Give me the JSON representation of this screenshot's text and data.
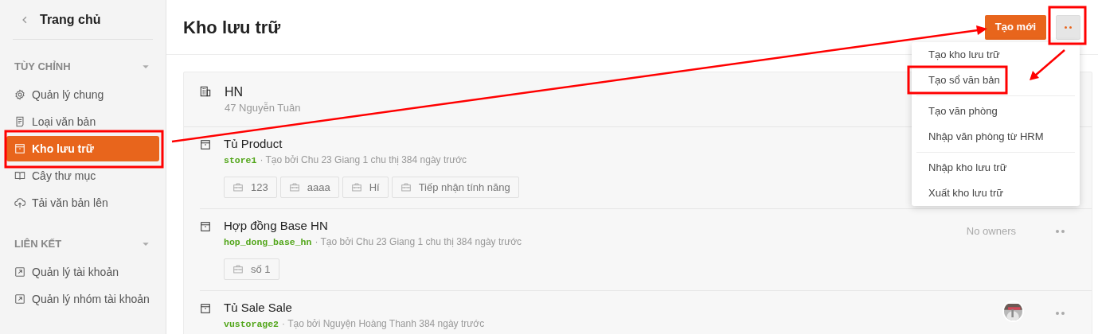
{
  "sidebar": {
    "back": {
      "label": "Trang chủ"
    },
    "sections": [
      {
        "title": "TÙY CHỈNH",
        "items": [
          {
            "label": "Quản lý chung",
            "kind": "gear",
            "selected": false
          },
          {
            "label": "Loại văn bản",
            "kind": "doc",
            "selected": false
          },
          {
            "label": "Kho lưu trữ",
            "kind": "archive",
            "selected": true
          },
          {
            "label": "Cây thư mục",
            "kind": "book",
            "selected": false
          },
          {
            "label": "Tải văn bản lên",
            "kind": "upload",
            "selected": false
          }
        ]
      },
      {
        "title": "LIÊN KẾT",
        "items": [
          {
            "label": "Quản lý tài khoản",
            "kind": "external",
            "selected": false
          },
          {
            "label": "Quản lý nhóm tài khoản",
            "kind": "external",
            "selected": false
          }
        ]
      }
    ]
  },
  "header": {
    "title": "Kho lưu trữ",
    "create_button": "Tạo mới",
    "more_button": {
      "expanded": true
    }
  },
  "menu": [
    [
      {
        "label": "Tạo kho lưu trữ"
      },
      {
        "label": "Tạo sổ văn bản"
      }
    ],
    [
      {
        "label": "Tạo văn phòng"
      },
      {
        "label": "Nhập văn phòng từ HRM"
      }
    ],
    [
      {
        "label": "Nhập kho lưu trữ"
      },
      {
        "label": "Xuất kho lưu trữ"
      }
    ]
  ],
  "office": {
    "name": "HN",
    "address": "47 Nguyễn Tuân",
    "storages": [
      {
        "title": "Tủ Product",
        "code": "store1",
        "meta": "· Tạo bởi Chu 23 Giang 1 chu thị 384 ngày trước",
        "books": [
          "123",
          "aaaa",
          "Hí",
          "Tiếp nhận tính năng"
        ]
      },
      {
        "title": "Hợp đồng Base HN",
        "code": "hop_dong_base_hn",
        "meta": "· Tạo bởi Chu 23 Giang 1 chu thị 384 ngày trước",
        "books": [
          "số 1"
        ],
        "owners": {
          "kind": "text",
          "label": "No owners"
        },
        "menu_button": true
      },
      {
        "title": "Tủ Sale Sale",
        "code": "vustorage2",
        "meta": "· Tạo bởi Nguyện Hoàng Thanh 384 ngày trước",
        "menu_button": true
      }
    ]
  }
}
